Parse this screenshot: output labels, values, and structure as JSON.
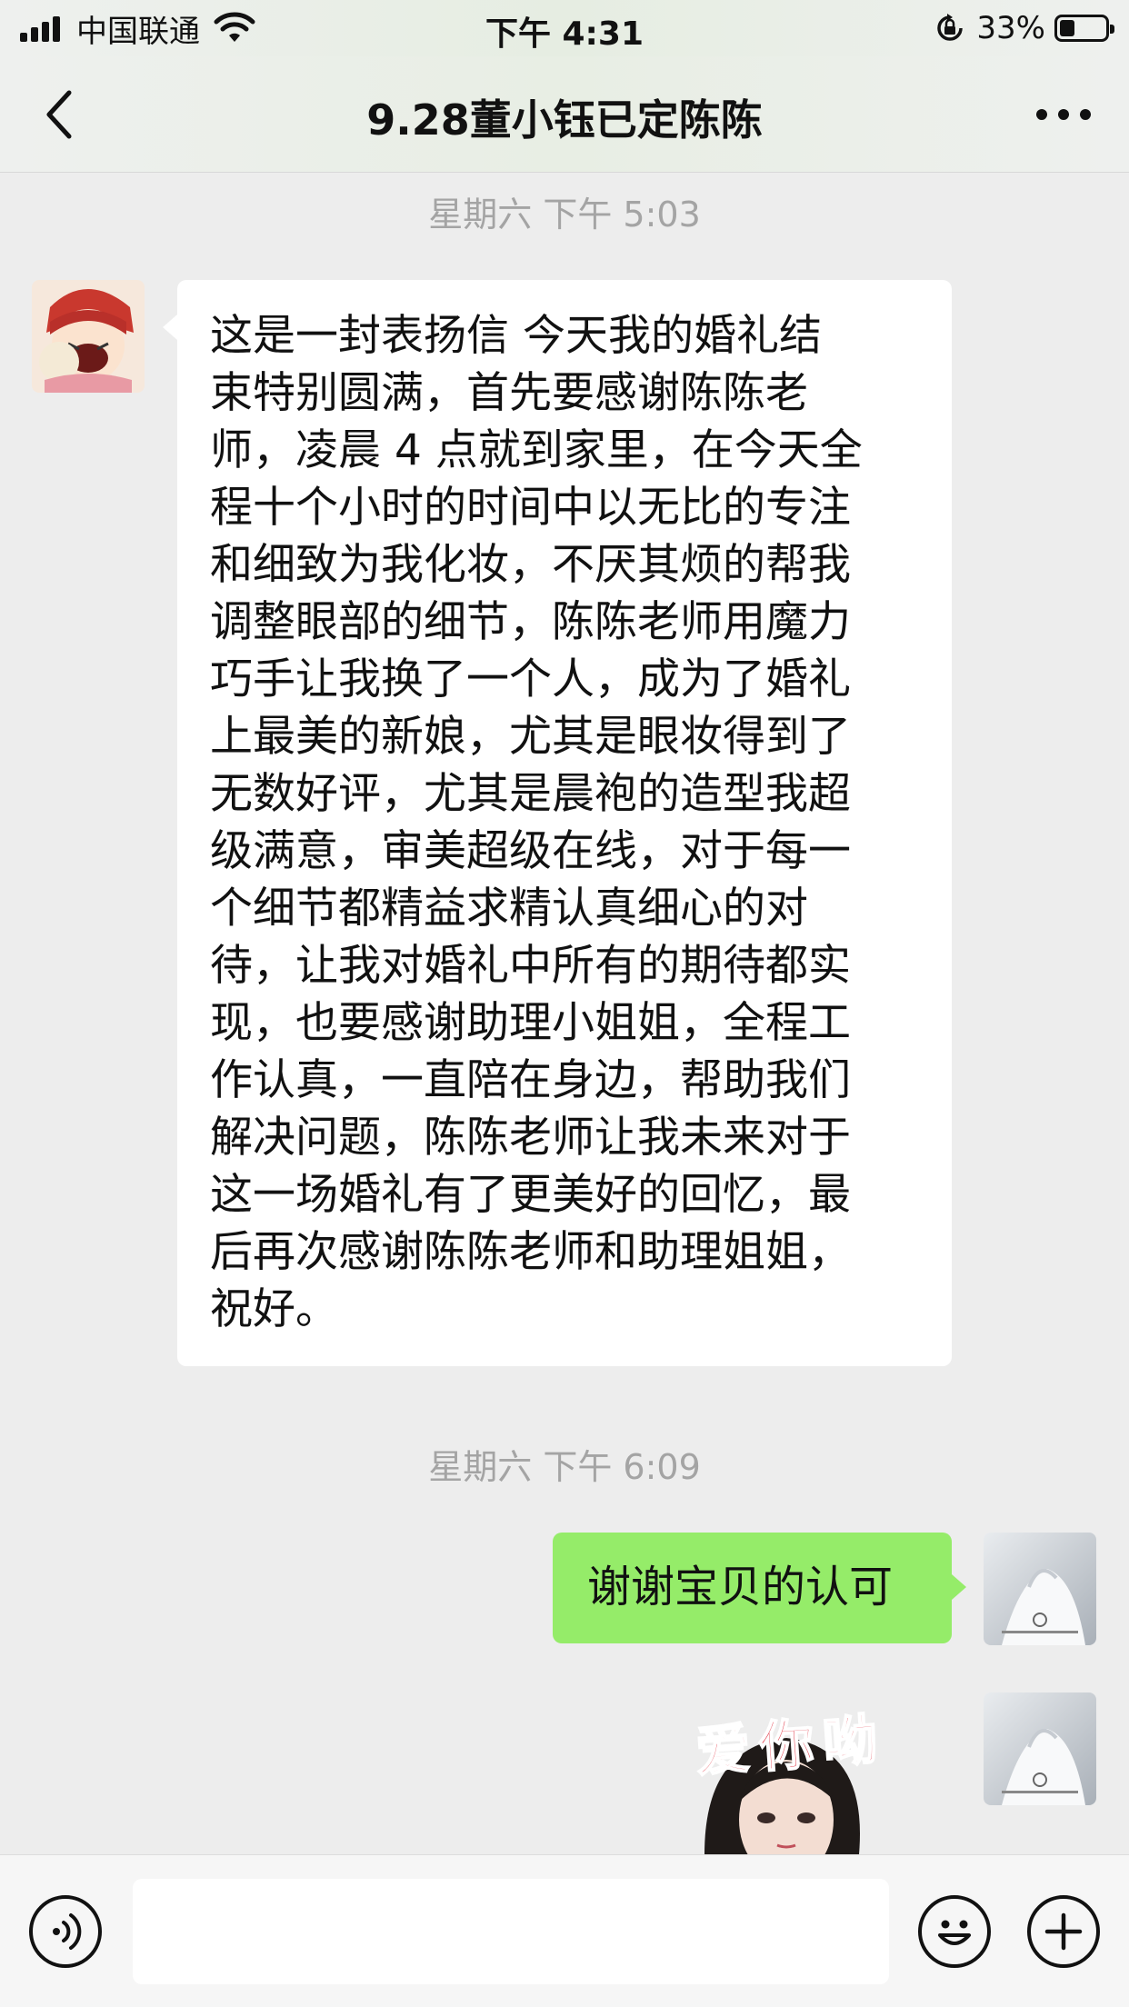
{
  "status_bar": {
    "carrier": "中国联通",
    "time": "下午 4:31",
    "battery_percent": "33%",
    "battery_level": 0.33,
    "icons": [
      "signal-icon",
      "wifi-icon",
      "rotation-lock-icon",
      "battery-icon"
    ]
  },
  "nav": {
    "title": "9.28董小钰已定陈陈",
    "back_icon": "chevron-left-icon",
    "more_icon": "more-dots-icon"
  },
  "messages": {
    "timestamp_1": "星期六 下午 5:03",
    "incoming_text": "这是一封表扬信  今天我的婚礼结\n束特别圆满，首先要感谢陈陈老\n师，凌晨 4 点就到家里，在今天全\n程十个小时的时间中以无比的专注\n和细致为我化妆，不厌其烦的帮我\n调整眼部的细节，陈陈老师用魔力\n巧手让我换了一个人，成为了婚礼\n上最美的新娘，尤其是眼妆得到了\n无数好评，尤其是晨袍的造型我超\n级满意，审美超级在线，对于每一\n个细节都精益求精认真细心的对\n待，让我对婚礼中所有的期待都实\n现，也要感谢助理小姐姐，全程工\n作认真，一直陪在身边，帮助我们\n解决问题，陈陈老师让我未来对于\n这一场婚礼有了更美好的回忆，最\n后再次感谢陈陈老师和助理姐姐，\n祝好。",
    "timestamp_2": "星期六 下午 6:09",
    "outgoing_text": "谢谢宝贝的认可",
    "sticker_text": "爱你呦"
  },
  "colors": {
    "background": "#ededed",
    "bubble_outgoing": "#95ec69",
    "bubble_incoming": "#ffffff",
    "timestamp": "#a4a4a4"
  },
  "input_bar": {
    "voice_icon": "voice-icon",
    "emoji_icon": "emoji-icon",
    "plus_icon": "plus-icon"
  }
}
